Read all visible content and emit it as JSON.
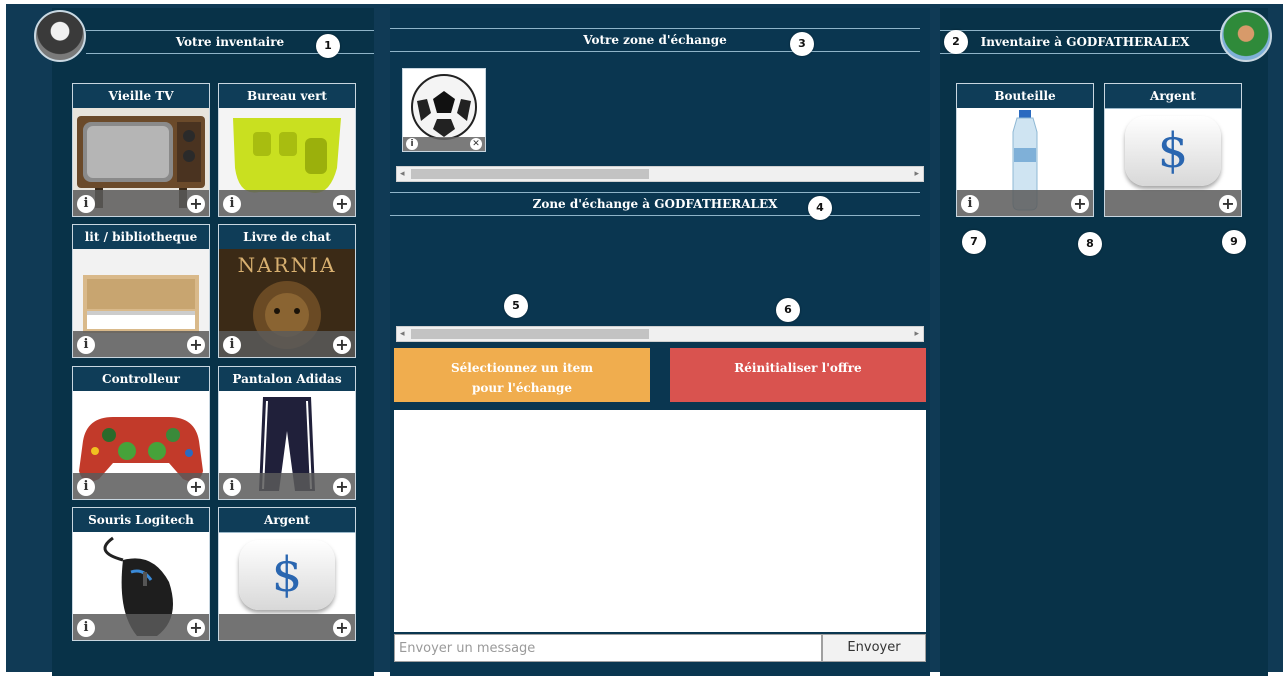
{
  "left": {
    "title": "Votre inventaire",
    "badge": "1",
    "items": [
      {
        "name": "Vieille TV"
      },
      {
        "name": "Bureau vert"
      },
      {
        "name": "lit / bibliotheque"
      },
      {
        "name": "Livre de chat",
        "cover_text": "NARNIA"
      },
      {
        "name": "Controlleur"
      },
      {
        "name": "Pantalon Adidas"
      },
      {
        "name": "Souris Logitech"
      },
      {
        "name": "Argent"
      }
    ]
  },
  "middle": {
    "your_zone_title": "Votre zone d'échange",
    "your_zone_badge": "3",
    "other_zone_title": "Zone d'échange à GODFATHERALEX",
    "other_zone_badge": "4",
    "badge5": "5",
    "badge6": "6",
    "select_button_line1": "Sélectionnez un item",
    "select_button_line2": "pour l'échange",
    "reset_button": "Réinitialiser l'offre",
    "message_placeholder": "Envoyer un message",
    "send_button": "Envoyer"
  },
  "right": {
    "title": "Inventaire à GODFATHERALEX",
    "badge": "2",
    "items": [
      {
        "name": "Bouteille"
      },
      {
        "name": "Argent"
      }
    ],
    "badge7": "7",
    "badge8": "8",
    "badge9": "9"
  },
  "icons": {
    "info": "i",
    "add": "+",
    "remove": "✕",
    "dollar": "$",
    "left_arrow": "◂",
    "right_arrow": "▸"
  },
  "colors": {
    "select_button": "#f0ad4e",
    "reset_button": "#d9534f",
    "panel_bg": "#083248"
  }
}
